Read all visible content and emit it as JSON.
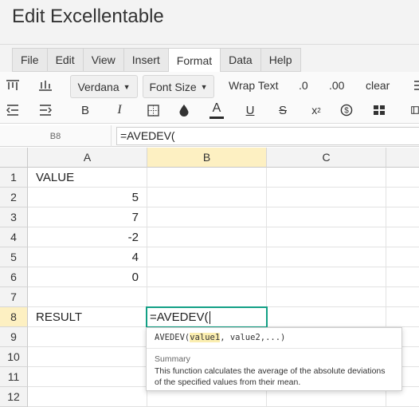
{
  "app": {
    "title": "Edit Excellentable"
  },
  "menu": {
    "tabs": [
      {
        "label": "File"
      },
      {
        "label": "Edit"
      },
      {
        "label": "View"
      },
      {
        "label": "Insert"
      },
      {
        "label": "Format",
        "active": true
      },
      {
        "label": "Data"
      },
      {
        "label": "Help"
      }
    ]
  },
  "toolbar": {
    "font_family": "Verdana",
    "font_size": "Font Size",
    "wrap_text": "Wrap Text",
    "decimals_less": ".0",
    "decimals_more": ".00",
    "clear": "clear",
    "bold": "B",
    "italic": "I",
    "font_color": "A",
    "underline": "U",
    "strikethrough": "S",
    "superscript": "x",
    "superscript_mark": "2",
    "accent_color": "#2a2a2a"
  },
  "formula_bar": {
    "cell_ref": "B8",
    "value": "=AVEDEV("
  },
  "grid": {
    "columns": [
      "A",
      "B",
      "C"
    ],
    "selected_column": "B",
    "rows": [
      "1",
      "2",
      "3",
      "4",
      "5",
      "6",
      "7",
      "8",
      "9",
      "10",
      "11",
      "12"
    ],
    "selected_row": "8",
    "cells": {
      "A1": "VALUE",
      "A2": "5",
      "A3": "7",
      "A4": "-2",
      "A5": "4",
      "A6": "0",
      "A8": "RESULT",
      "B8": "=AVEDEV("
    },
    "edit_border_color": "#12a085",
    "header_highlight_color": "#fdf0c2"
  },
  "tooltip": {
    "fn_name": "AVEDEV(",
    "arg_current": "value1",
    "args_rest": ", value2,...)",
    "summary_heading": "Summary",
    "summary_text": "This function calculates the average of the absolute deviations of the specified values from their mean."
  }
}
